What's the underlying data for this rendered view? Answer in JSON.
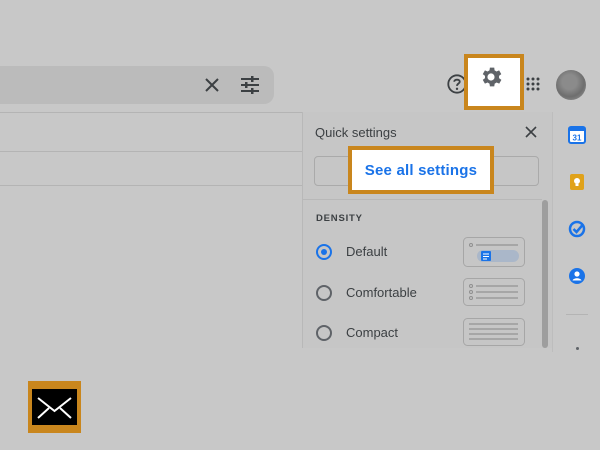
{
  "search": {
    "clear_icon": "close-icon",
    "filter_icon": "tune-icon"
  },
  "header": {
    "help_icon": "help-icon",
    "settings_icon": "gear-icon",
    "apps_icon": "apps-grid-icon",
    "avatar": "avatar"
  },
  "quick_settings": {
    "title": "Quick settings",
    "close_icon": "close-icon",
    "see_all_label": "See all settings",
    "density_heading": "DENSITY",
    "options": [
      {
        "label": "Default",
        "selected": true
      },
      {
        "label": "Comfortable",
        "selected": false
      },
      {
        "label": "Compact",
        "selected": false
      }
    ]
  },
  "side_rail": {
    "calendar_day": "31",
    "icons": [
      "calendar-icon",
      "keep-icon",
      "tasks-icon",
      "contacts-icon"
    ]
  },
  "colors": {
    "highlight": "#c9861d",
    "accent": "#1a73e8"
  }
}
